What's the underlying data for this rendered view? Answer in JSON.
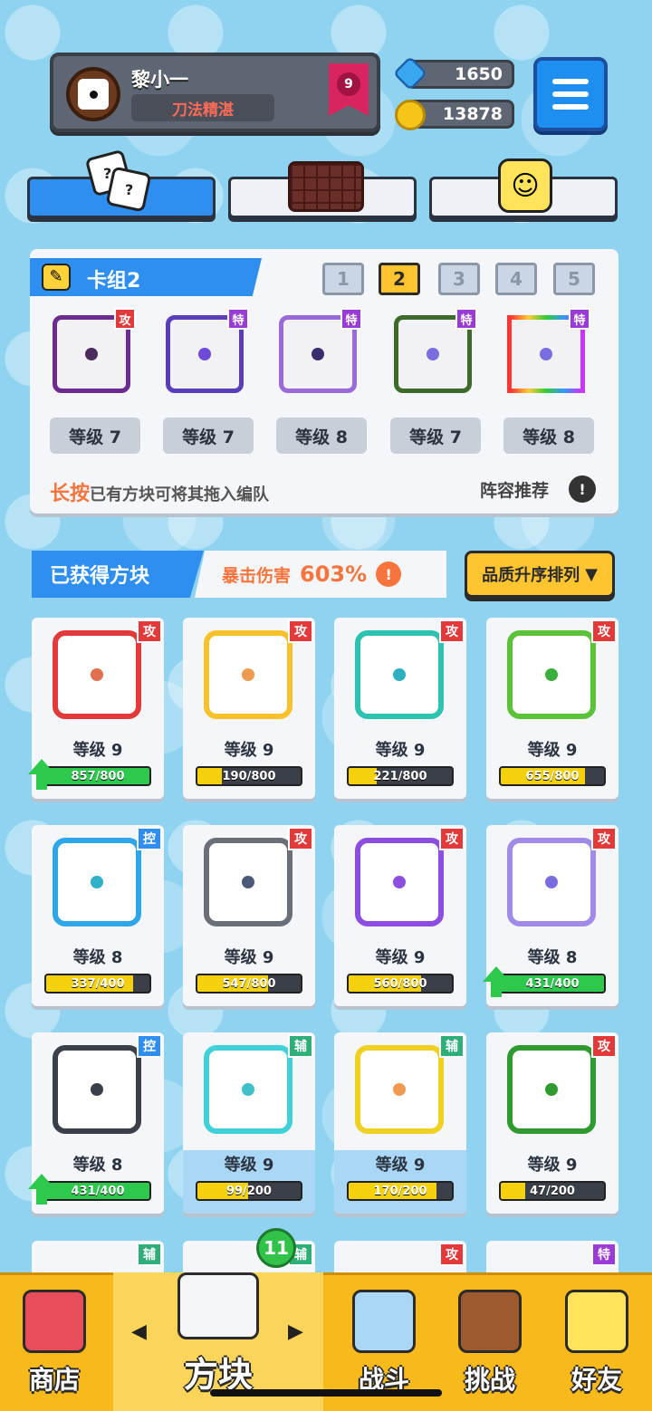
{
  "player": {
    "name": "黎小一",
    "title": "刀法精湛",
    "rank": "9"
  },
  "currency": {
    "gems": "1650",
    "coins": "13878"
  },
  "icons": {
    "menu": "hamburger-menu-icon",
    "gem": "gem-icon",
    "coin": "coin-icon"
  },
  "deck": {
    "title": "卡组2",
    "numbers": [
      "1",
      "2",
      "3",
      "4",
      "5"
    ],
    "active": "2",
    "slots": [
      {
        "tag": "攻",
        "level": "等级 7"
      },
      {
        "tag": "特",
        "level": "等级 7"
      },
      {
        "tag": "特",
        "level": "等级 8"
      },
      {
        "tag": "特",
        "level": "等级 7"
      },
      {
        "tag": "特",
        "level": "等级 8"
      }
    ],
    "hint_emph": "长按",
    "hint_rest": "已有方块可将其拖入编队",
    "recommend": "阵容推荐",
    "info": "!"
  },
  "owned": {
    "title": "已获得方块",
    "crit_label": "暴击伤害",
    "crit_value": "603%",
    "info": "!",
    "sort_label": "品质升序排列",
    "sort_arrow": "▼"
  },
  "cards": [
    {
      "tag": "攻",
      "level": "等级 9",
      "progress": "857/800"
    },
    {
      "tag": "攻",
      "level": "等级 9",
      "progress": "190/800"
    },
    {
      "tag": "攻",
      "level": "等级 9",
      "progress": "221/800"
    },
    {
      "tag": "攻",
      "level": "等级 9",
      "progress": "655/800"
    },
    {
      "tag": "控",
      "level": "等级 8",
      "progress": "337/400"
    },
    {
      "tag": "攻",
      "level": "等级 9",
      "progress": "547/800"
    },
    {
      "tag": "攻",
      "level": "等级 9",
      "progress": "560/800"
    },
    {
      "tag": "攻",
      "level": "等级 8",
      "progress": "431/400"
    },
    {
      "tag": "控",
      "level": "等级 8",
      "progress": "431/400"
    },
    {
      "tag": "辅",
      "level": "等级 9",
      "progress": "99/200"
    },
    {
      "tag": "辅",
      "level": "等级 9",
      "progress": "170/200"
    },
    {
      "tag": "攻",
      "level": "等级 9",
      "progress": "47/200"
    }
  ],
  "partial_tags": [
    "辅",
    "辅",
    "攻",
    "特"
  ],
  "nav": {
    "shop": "商店",
    "blocks": "方块",
    "battle": "战斗",
    "challenge": "挑战",
    "friends": "好友",
    "badge": "11",
    "arrow_left": "◀",
    "arrow_right": "▶"
  }
}
